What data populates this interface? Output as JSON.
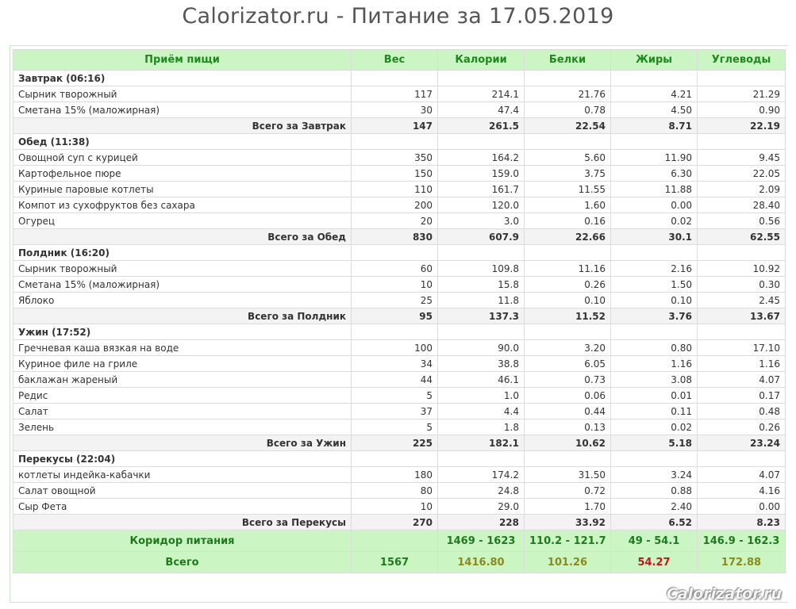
{
  "page_title": "Calorizator.ru - Питание за 17.05.2019",
  "headers": [
    "Приём пищи",
    "Вес",
    "Калории",
    "Белки",
    "Жиры",
    "Углеводы"
  ],
  "meals": [
    {
      "name": "Завтрак (06:16)",
      "items": [
        {
          "name": "Сырник творожный",
          "weight": "117",
          "cal": "214.1",
          "prot": "21.76",
          "fat": "4.21",
          "carb": "21.29"
        },
        {
          "name": "Сметана 15% (маложирная)",
          "weight": "30",
          "cal": "47.4",
          "prot": "0.78",
          "fat": "4.50",
          "carb": "0.90"
        }
      ],
      "total": {
        "label": "Всего за Завтрак",
        "weight": "147",
        "cal": "261.5",
        "prot": "22.54",
        "fat": "8.71",
        "carb": "22.19"
      }
    },
    {
      "name": "Обед (11:38)",
      "items": [
        {
          "name": "Овощной суп с курицей",
          "weight": "350",
          "cal": "164.2",
          "prot": "5.60",
          "fat": "11.90",
          "carb": "9.45"
        },
        {
          "name": "Картофельное пюре",
          "weight": "150",
          "cal": "159.0",
          "prot": "3.75",
          "fat": "6.30",
          "carb": "22.05"
        },
        {
          "name": "Куриные паровые котлеты",
          "weight": "110",
          "cal": "161.7",
          "prot": "11.55",
          "fat": "11.88",
          "carb": "2.09"
        },
        {
          "name": "Компот из сухофруктов без сахара",
          "weight": "200",
          "cal": "120.0",
          "prot": "1.60",
          "fat": "0.00",
          "carb": "28.40"
        },
        {
          "name": "Огурец",
          "weight": "20",
          "cal": "3.0",
          "prot": "0.16",
          "fat": "0.02",
          "carb": "0.56"
        }
      ],
      "total": {
        "label": "Всего за Обед",
        "weight": "830",
        "cal": "607.9",
        "prot": "22.66",
        "fat": "30.1",
        "carb": "62.55"
      }
    },
    {
      "name": "Полдник (16:20)",
      "items": [
        {
          "name": "Сырник творожный",
          "weight": "60",
          "cal": "109.8",
          "prot": "11.16",
          "fat": "2.16",
          "carb": "10.92"
        },
        {
          "name": "Сметана 15% (маложирная)",
          "weight": "10",
          "cal": "15.8",
          "prot": "0.26",
          "fat": "1.50",
          "carb": "0.30"
        },
        {
          "name": "Яблоко",
          "weight": "25",
          "cal": "11.8",
          "prot": "0.10",
          "fat": "0.10",
          "carb": "2.45"
        }
      ],
      "total": {
        "label": "Всего за Полдник",
        "weight": "95",
        "cal": "137.3",
        "prot": "11.52",
        "fat": "3.76",
        "carb": "13.67"
      }
    },
    {
      "name": "Ужин (17:52)",
      "items": [
        {
          "name": "Гречневая каша вязкая на воде",
          "weight": "100",
          "cal": "90.0",
          "prot": "3.20",
          "fat": "0.80",
          "carb": "17.10"
        },
        {
          "name": "Куриное филе на гриле",
          "weight": "34",
          "cal": "38.8",
          "prot": "6.05",
          "fat": "1.16",
          "carb": "1.16"
        },
        {
          "name": "баклажан жареный",
          "weight": "44",
          "cal": "46.1",
          "prot": "0.73",
          "fat": "3.08",
          "carb": "4.07"
        },
        {
          "name": "Редис",
          "weight": "5",
          "cal": "1.0",
          "prot": "0.06",
          "fat": "0.01",
          "carb": "0.17"
        },
        {
          "name": "Салат",
          "weight": "37",
          "cal": "4.4",
          "prot": "0.44",
          "fat": "0.11",
          "carb": "0.48"
        },
        {
          "name": "Зелень",
          "weight": "5",
          "cal": "1.8",
          "prot": "0.13",
          "fat": "0.02",
          "carb": "0.26"
        }
      ],
      "total": {
        "label": "Всего за Ужин",
        "weight": "225",
        "cal": "182.1",
        "prot": "10.62",
        "fat": "5.18",
        "carb": "23.24"
      }
    },
    {
      "name": "Перекусы (22:04)",
      "items": [
        {
          "name": "котлеты индейка-кабачки",
          "weight": "180",
          "cal": "174.2",
          "prot": "31.50",
          "fat": "3.24",
          "carb": "4.07"
        },
        {
          "name": "Салат овощной",
          "weight": "80",
          "cal": "24.8",
          "prot": "0.72",
          "fat": "0.88",
          "carb": "4.16"
        },
        {
          "name": "Сыр Фета",
          "weight": "10",
          "cal": "29.0",
          "prot": "1.70",
          "fat": "2.40",
          "carb": "0.00"
        }
      ],
      "total": {
        "label": "Всего за Перекусы",
        "weight": "270",
        "cal": "228",
        "prot": "33.92",
        "fat": "6.52",
        "carb": "8.23"
      }
    }
  ],
  "corridor": {
    "label": "Коридор питания",
    "weight": "",
    "cal": "1469 - 1623",
    "prot": "110.2 - 121.7",
    "fat": "49 - 54.1",
    "carb": "146.9 - 162.3"
  },
  "grand_total": {
    "label": "Всего",
    "weight": "1567",
    "cal": "1416.80",
    "prot": "101.26",
    "fat": "54.27",
    "carb": "172.88"
  },
  "watermark": "Calorizator.ru",
  "colors": {
    "header_bg": "#ccf5c4",
    "header_text": "#1e8a1e",
    "sum_bg": "#f3f3f3",
    "over_limit": "#c01818",
    "under_limit": "#8a8a1e"
  }
}
